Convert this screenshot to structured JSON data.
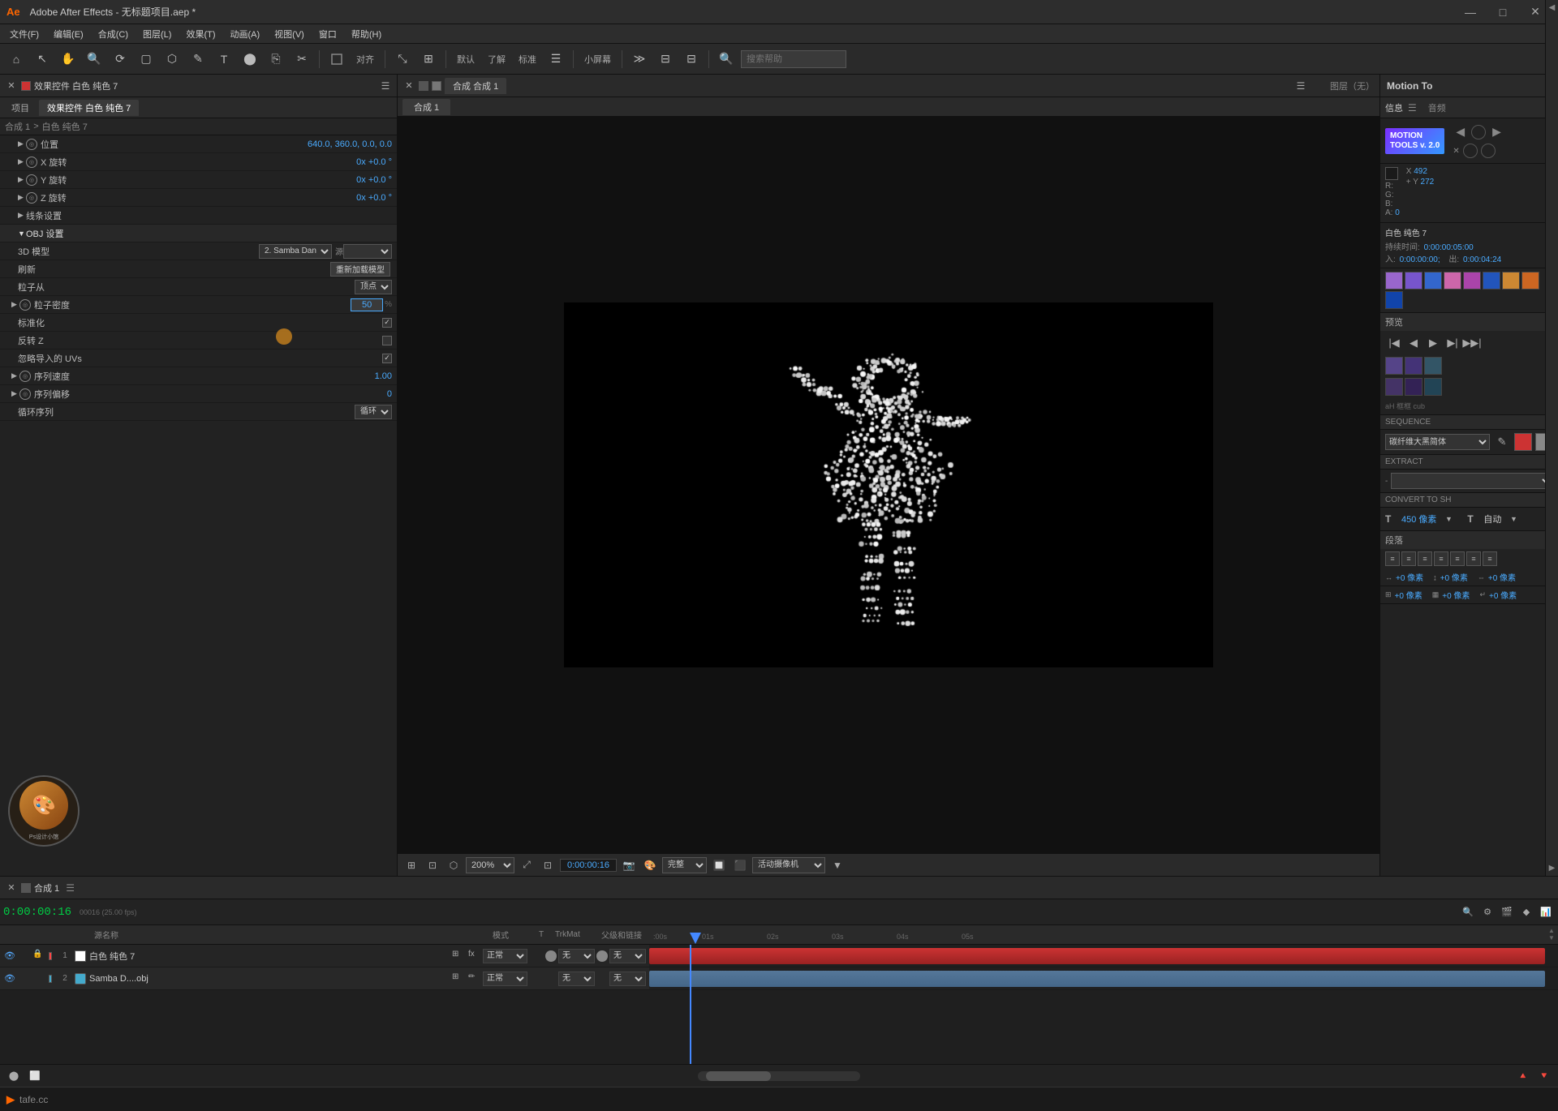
{
  "titleBar": {
    "logo": "Ae",
    "title": "Adobe After Effects - 无标题项目.aep *",
    "minimize": "—",
    "maximize": "□",
    "close": "✕"
  },
  "menuBar": {
    "items": [
      "文件(F)",
      "编辑(E)",
      "合成(C)",
      "图层(L)",
      "效果(T)",
      "动画(A)",
      "视图(V)",
      "窗口",
      "帮助(H)"
    ]
  },
  "toolbar": {
    "tools": [
      "🏠",
      "↖",
      "✋",
      "🔍",
      "⤡",
      "▣",
      "✎",
      "T",
      "⬡",
      "🖋",
      "⬤",
      "⊞",
      "✂"
    ],
    "align_label": "对齐",
    "standard_label": "标准",
    "monitor_label": "小屏幕",
    "search_placeholder": "搜索帮助"
  },
  "leftPanel": {
    "tabs": [
      "项目",
      "效果控件 白色 纯色 7"
    ],
    "breadcrumb": "合成 1 > 白色 纯色 7",
    "properties": {
      "position_label": "位置",
      "position_value": "640.0, 360.0, 0.0, 0.0",
      "x_rotate_label": "X 旋转",
      "x_rotate_value": "0x +0.0 °",
      "y_rotate_label": "Y 旋转",
      "y_rotate_value": "0x +0.0 °",
      "z_rotate_label": "Z 旋转",
      "z_rotate_value": "0x +0.0 °",
      "wire_label": "线条设置",
      "obj_label": "OBJ 设置",
      "model_3d_label": "3D 模型",
      "model_3d_value": "2. Samba Dan",
      "source_label": "源",
      "refresh_label": "刷新",
      "reload_btn": "重新加载模型",
      "particles_from_label": "粒子从",
      "particles_from_value": "顶点",
      "density_label": "粒子密度",
      "density_value": "50",
      "density_unit": "%",
      "normalize_label": "标准化",
      "reverse_z_label": "反转 Z",
      "ignore_uvs_label": "忽略导入的 UVs",
      "seq_speed_label": "序列速度",
      "seq_speed_value": "1.00",
      "seq_offset_label": "序列偏移",
      "seq_offset_value": "0",
      "loop_label": "循环序列",
      "loop_value": "循环"
    }
  },
  "compositionPanel": {
    "tab": "合成 1",
    "layer_label": "图层（无）",
    "zoom": "200%",
    "timecode": "0:00:00:16",
    "quality": "完整",
    "camera": "活动摄像机"
  },
  "rightPanel": {
    "motion_to_label": "Motion To",
    "motion_tools_label": "MOTION\nTOOLS v. 2.0",
    "info_label": "信息",
    "audio_label": "音频",
    "r_label": "R:",
    "g_label": "G:",
    "b_label": "B:",
    "a_label": "A:",
    "r_value": "",
    "g_value": "",
    "b_value": "",
    "a_value": "0",
    "x_label": "X",
    "y_label": "Y",
    "x_value": "492",
    "y_value": "272",
    "layer_name": "白色 纯色 7",
    "duration_label": "持续时间:",
    "duration_value": "0:00:00:05:00",
    "in_label": "入:",
    "in_value": "0:00:00:00;",
    "out_label": "出:",
    "out_value": "0:00:04:24",
    "preview_label": "预览",
    "sequence_label": "SEQUENCE",
    "font_select": "碳纤维大黑简体",
    "extract_label": "EXTRACT",
    "convert_label": "CONVERT TO SH",
    "size_label": "450 像素",
    "size_unit": "自动",
    "paragraph_label": "段落",
    "swatches": [
      "#9966cc",
      "#7755cc",
      "#3366cc",
      "#cc66aa",
      "#aa44aa",
      "#2255bb",
      "#cc8833",
      "#cc6622",
      "#1144aa"
    ]
  },
  "timeline": {
    "comp_name": "合成 1",
    "timecode": "0:00:00:16",
    "timecode_sub": "00016 (25.00 fps)",
    "ruler_marks": [
      "00s",
      "01s",
      "02s",
      "03s",
      "04s",
      "05s"
    ],
    "layers": [
      {
        "num": "1",
        "color": "#ff4444",
        "name": "白色 纯色 7",
        "mode": "正常",
        "trk_mat": "无",
        "parent": "无"
      },
      {
        "num": "2",
        "color": "#44aacc",
        "name": "Samba D....obj",
        "mode": "正常",
        "trk_mat": "无",
        "parent": "无"
      }
    ],
    "col_labels": [
      "源名称",
      "模式",
      "T",
      "TrkMat",
      "父级和链接"
    ]
  }
}
